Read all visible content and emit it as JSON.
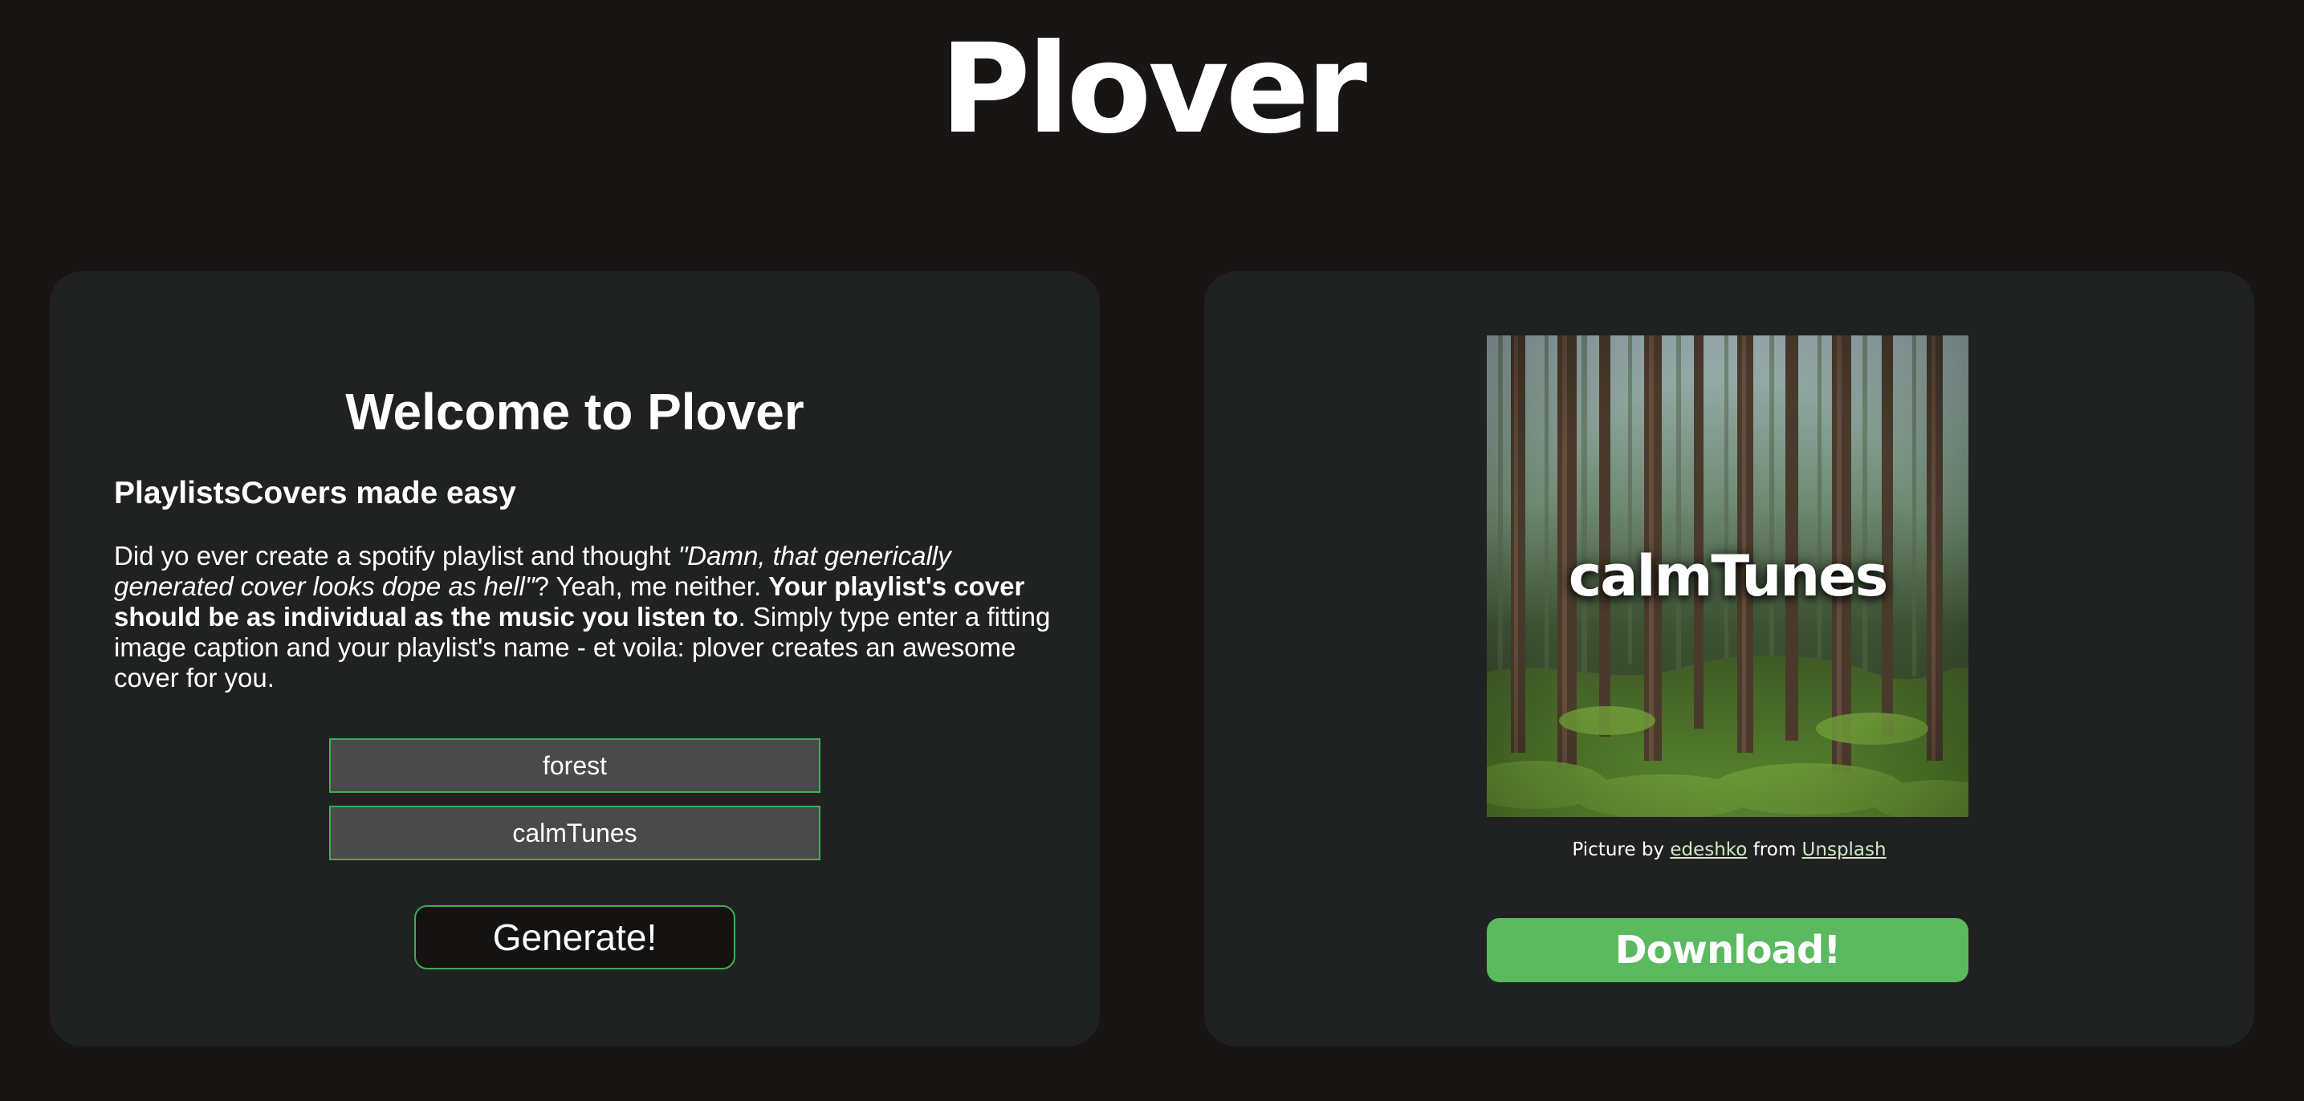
{
  "app": {
    "title": "Plover"
  },
  "generator_panel": {
    "heading": "Welcome to Plover",
    "subheading": "PlaylistsCovers made easy",
    "description": {
      "part1": "Did yo ever create a spotify playlist and thought ",
      "quote": "\"Damn, that generically generated cover looks dope as hell\"",
      "part2": "? Yeah, me neither. ",
      "bold": "Your playlist's cover should be as individual as the music you listen to",
      "part3": ". Simply type enter a fitting image caption and your playlist's name - et voila: plover creates an awesome cover for you."
    },
    "caption_input": {
      "value": "forest"
    },
    "name_input": {
      "value": "calmTunes"
    },
    "generate_button_label": "Generate!"
  },
  "preview_panel": {
    "cover_image": {
      "subject": "forest",
      "overlay_text": "calmTunes"
    },
    "attribution": {
      "prefix": "Picture by ",
      "author": "edeshko",
      "middle": " from ",
      "source": "Unsplash"
    },
    "download_button_label": "Download!"
  },
  "colors": {
    "page_background": "#181514",
    "card_background": "#202222",
    "accent_green": "#5bb960",
    "input_border_green": "#3fae4f",
    "input_background": "#4a4a4a"
  }
}
